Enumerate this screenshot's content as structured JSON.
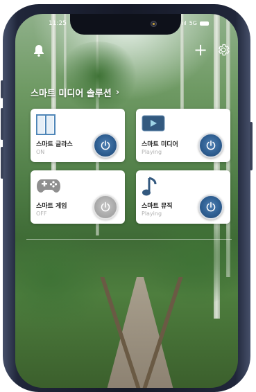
{
  "status_bar": {
    "time": "11:25",
    "signal": "5G"
  },
  "header": {
    "section_title": "스마트 미디어 솔루션"
  },
  "devices": [
    {
      "name": "스마트 글라스",
      "status": "ON",
      "icon": "window-icon",
      "power": "on"
    },
    {
      "name": "스마트 미디어",
      "status": "Playing",
      "icon": "video-icon",
      "power": "on"
    },
    {
      "name": "스마트 게임",
      "status": "OFF",
      "icon": "gamepad-icon",
      "power": "off"
    },
    {
      "name": "스마트 뮤직",
      "status": "Playing",
      "icon": "music-note-icon",
      "power": "on"
    }
  ],
  "colors": {
    "power_on": "#2f5f92",
    "power_off": "#a9a9a9",
    "card_bg": "#ffffff"
  }
}
